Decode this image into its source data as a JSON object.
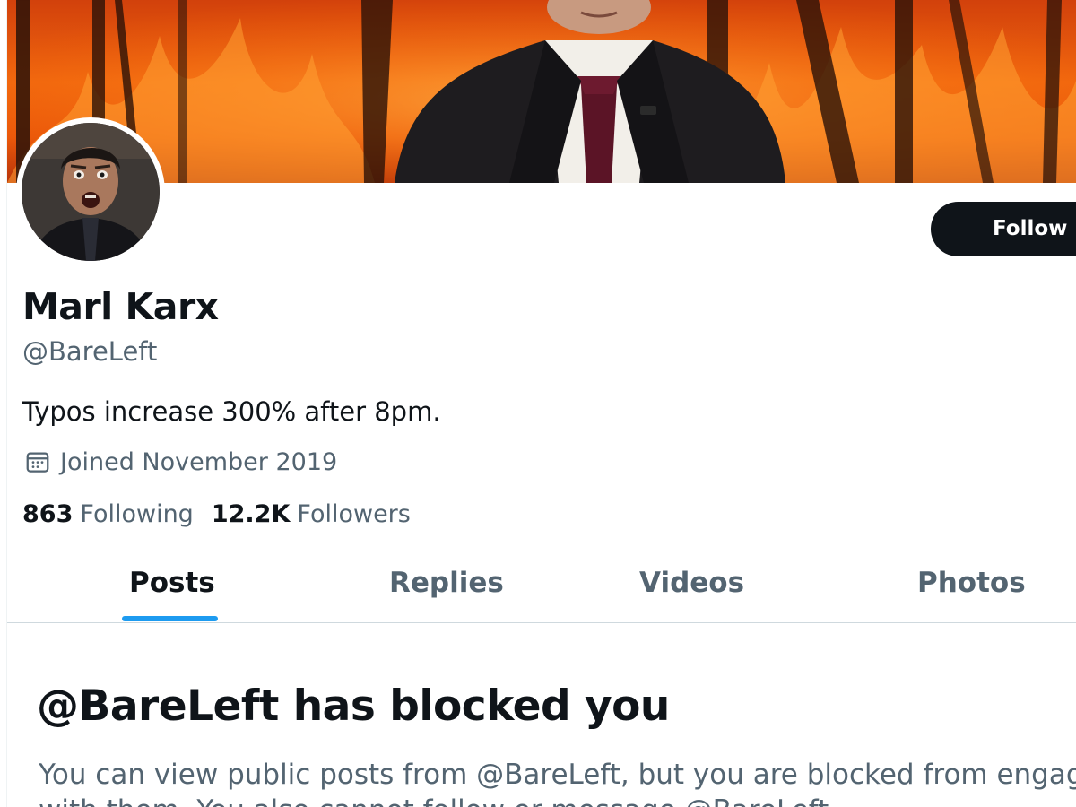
{
  "profile": {
    "display_name": "Marl Karx",
    "handle": "@BareLeft",
    "bio": "Typos increase 300% after 8pm.",
    "joined": "Joined November 2019",
    "following_count": "863",
    "following_label": "Following",
    "followers_count": "12.2K",
    "followers_label": "Followers"
  },
  "actions": {
    "follow_label": "Follow"
  },
  "tabs": [
    {
      "label": "Posts",
      "active": true
    },
    {
      "label": "Replies",
      "active": false
    },
    {
      "label": "Videos",
      "active": false
    },
    {
      "label": "Photos",
      "active": false
    }
  ],
  "blocked": {
    "title": "@BareLeft has blocked you",
    "body": "You can view public posts from @BareLeft, but you are blocked from engaging with them. You also cannot follow or message @BareLeft."
  },
  "colors": {
    "accent": "#1d9bf0",
    "text_primary": "#0f1419",
    "text_secondary": "#536471",
    "follow_button_bg": "#0f1419"
  },
  "icons": {
    "joined": "calendar-icon"
  }
}
